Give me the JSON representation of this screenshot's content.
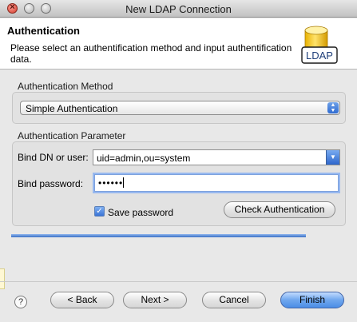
{
  "window": {
    "title": "New LDAP Connection"
  },
  "header": {
    "title": "Authentication",
    "description": "Please select an authentification method and input authentification data.",
    "icon": "ldap-database-icon",
    "icon_label": "LDAP"
  },
  "auth_method": {
    "group_label": "Authentication Method",
    "selected": "Simple Authentication"
  },
  "auth_params": {
    "group_label": "Authentication Parameter",
    "bind_dn_label": "Bind DN or user:",
    "bind_dn_value": "uid=admin,ou=system",
    "bind_password_label": "Bind password:",
    "bind_password_value": "••••••",
    "save_password_label": "Save password",
    "save_password_checked": true,
    "check_button_label": "Check Authentication"
  },
  "footer": {
    "back_label": "< Back",
    "next_label": "Next >",
    "cancel_label": "Cancel",
    "finish_label": "Finish"
  },
  "colors": {
    "accent": "#3a74d6",
    "default_button": "#6fa7ee"
  }
}
